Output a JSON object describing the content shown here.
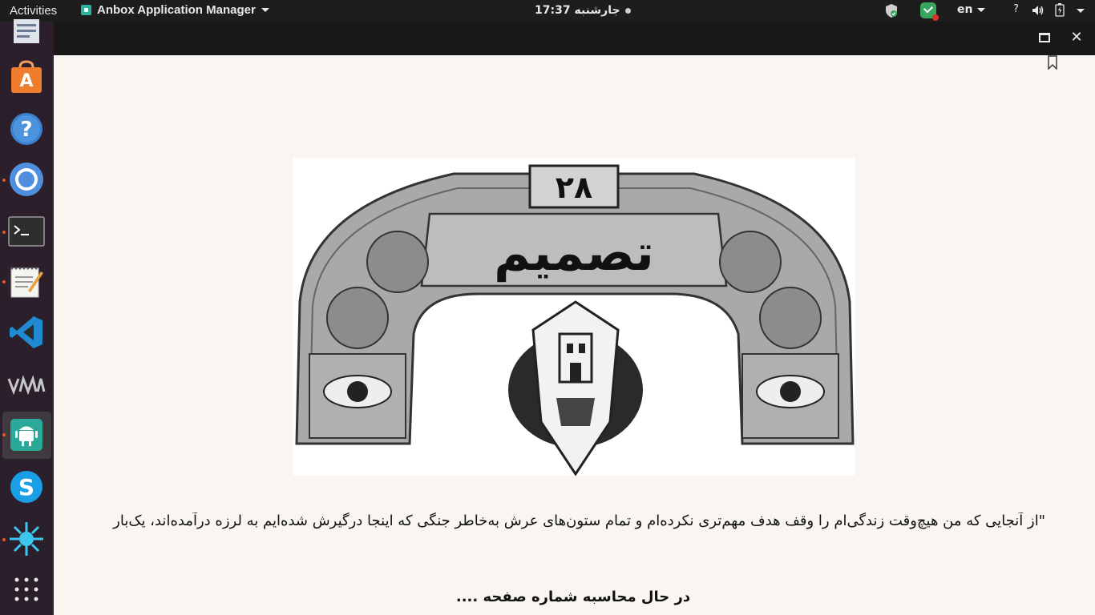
{
  "topbar": {
    "activities": "Activities",
    "app_name": "Anbox Application Manager",
    "clock": "جارشنبه 17:37",
    "lang": "en",
    "help": "?"
  },
  "dock": {
    "items": [
      {
        "name": "files-icon"
      },
      {
        "name": "software-center-icon"
      },
      {
        "name": "help-icon"
      },
      {
        "name": "chromium-icon"
      },
      {
        "name": "terminal-icon"
      },
      {
        "name": "text-editor-icon"
      },
      {
        "name": "vscode-icon"
      },
      {
        "name": "vmware-icon"
      },
      {
        "name": "anbox-icon"
      },
      {
        "name": "skype-icon"
      },
      {
        "name": "splash-app-icon"
      },
      {
        "name": "show-apps-icon"
      }
    ]
  },
  "window": {
    "maximize": "maximize-icon",
    "close": "close-icon"
  },
  "illustration": {
    "number": "۲۸",
    "title": "تصمیم"
  },
  "content": {
    "quote": "\"از آنجایی که من هیچ‌وقت زندگی‌ام را وقف هدف مهم‌تری نکرده‌ام و تمام ستون‌های عرش به‌خاطر جنگی که اینجا درگیرش شده‌ایم به لرزه درآمده‌اند، یک‌بار دیگر از تو",
    "status": "در حال محاسبه شماره صفحه ...."
  },
  "colors": {
    "topbar": "#1d1d1d",
    "dock": "#2b1f2c",
    "page": "#f9f6f1",
    "accent": "#e95420"
  }
}
